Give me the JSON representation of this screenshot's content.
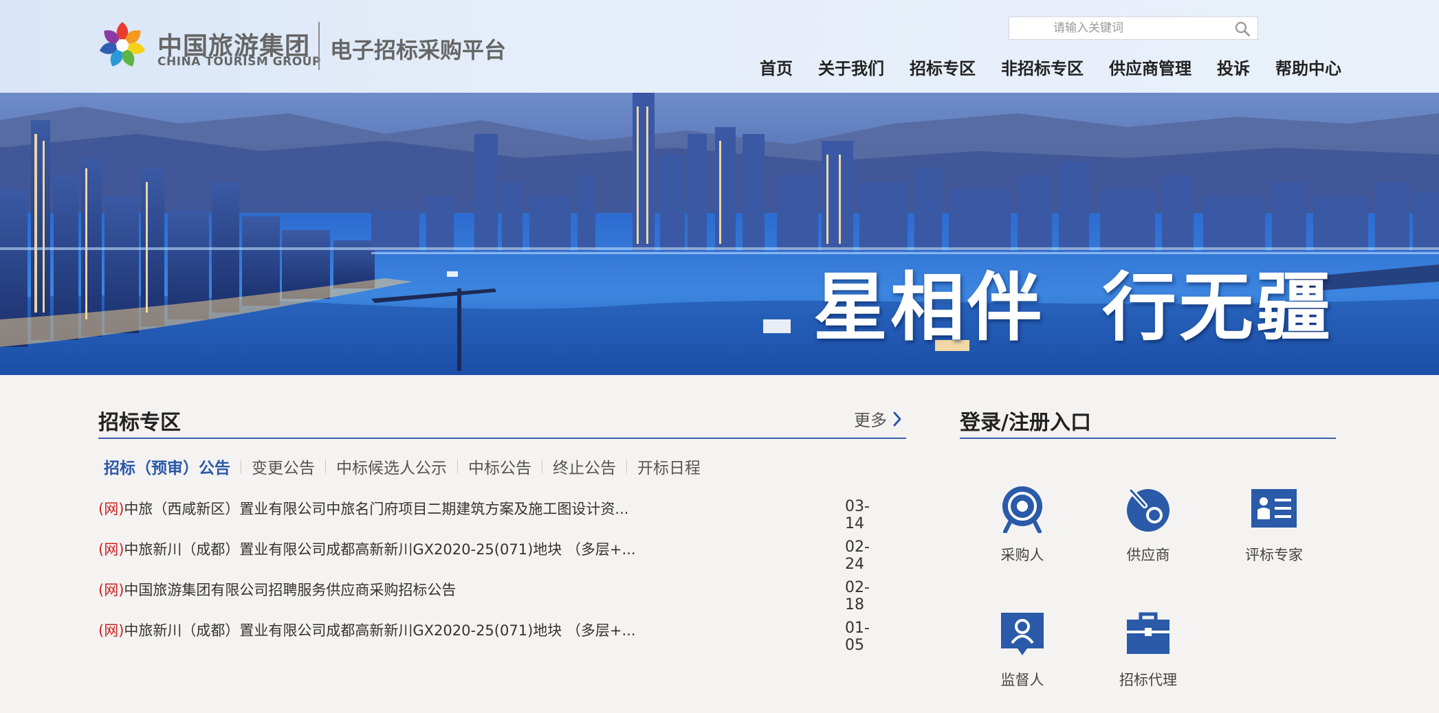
{
  "header": {
    "logo_cn": "中国旅游集团",
    "logo_en": "CHINA TOURISM GROUP",
    "platform_title": "电子招标采购平台",
    "search": {
      "placeholder": "请输入关键词",
      "value": ""
    },
    "nav": [
      "首页",
      "关于我们",
      "招标专区",
      "非招标专区",
      "供应商管理",
      "投诉",
      "帮助中心"
    ]
  },
  "banner": {
    "slogan_left": "星相伴",
    "slogan_right": "行无疆"
  },
  "bidding": {
    "title": "招标专区",
    "more_label": "更多",
    "tabs": [
      "招标（预审）公告",
      "变更公告",
      "中标候选人公示",
      "中标公告",
      "终止公告",
      "开标日程"
    ],
    "active_tab": 0,
    "notices": [
      {
        "prefix": "(网)",
        "title": "中旅（西咸新区）置业有限公司中旅名门府项目二期建筑方案及施工图设计资...",
        "date": "03-14"
      },
      {
        "prefix": "(网)",
        "title": "中旅新川（成都）置业有限公司成都高新新川GX2020-25(071)地块 （多层+...",
        "date": "02-24"
      },
      {
        "prefix": "(网)",
        "title": "中国旅游集团有限公司招聘服务供应商采购招标公告",
        "date": "02-18"
      },
      {
        "prefix": "(网)",
        "title": "中旅新川（成都）置业有限公司成都高新新川GX2020-25(071)地块 （多层+...",
        "date": "01-05"
      }
    ]
  },
  "login": {
    "title": "登录/注册入口",
    "entries": [
      {
        "label": "采购人",
        "icon": "purchaser-icon"
      },
      {
        "label": "供应商",
        "icon": "supplier-icon"
      },
      {
        "label": "评标专家",
        "icon": "expert-icon"
      },
      {
        "label": "监督人",
        "icon": "supervisor-icon"
      },
      {
        "label": "招标代理",
        "icon": "agent-icon"
      }
    ]
  },
  "colors": {
    "accent": "#2a58a8",
    "icon_blue": "#2a5aa8",
    "notice_prefix": "#d02020",
    "header_bg": "#e2ebf8",
    "page_bg": "#f4f3f2"
  }
}
